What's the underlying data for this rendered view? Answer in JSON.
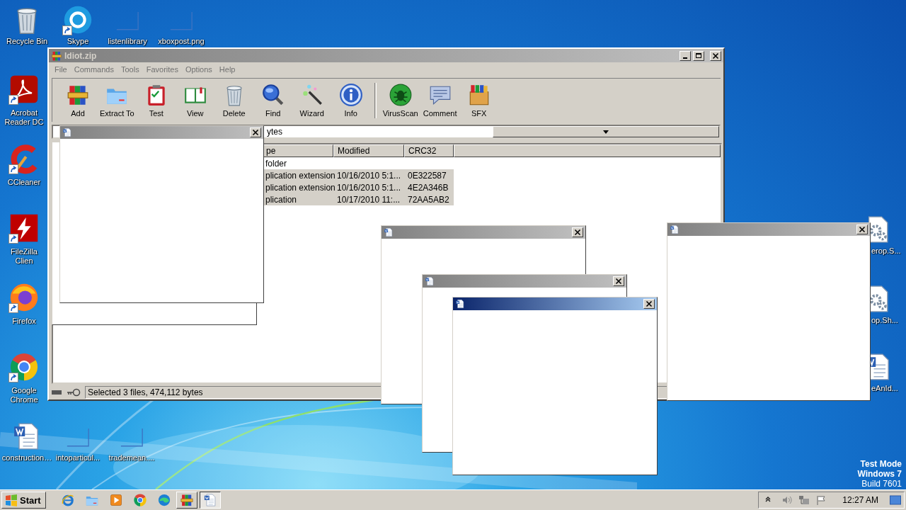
{
  "desktop_icons": [
    {
      "label": "Recycle Bin",
      "shortcut": false
    },
    {
      "label": "Skype",
      "shortcut": true
    },
    {
      "label": "listenlibrary",
      "shortcut": false
    },
    {
      "label": "xboxpost.png",
      "shortcut": false
    },
    {
      "label": "Acrobat Reader DC",
      "shortcut": true
    },
    {
      "label": "CCleaner",
      "shortcut": true
    },
    {
      "label": "FileZilla Clien",
      "shortcut": true
    },
    {
      "label": "Firefox",
      "shortcut": true
    },
    {
      "label": "Google Chrome",
      "shortcut": true
    },
    {
      "label": "construction…",
      "shortcut": false
    },
    {
      "label": "intoparticul...",
      "shortcut": false
    },
    {
      "label": "trademean....",
      "shortcut": false
    },
    {
      "label": "erop.S...",
      "shortcut": false
    },
    {
      "label": "op.Sh...",
      "shortcut": false
    },
    {
      "label": "eAnId...",
      "shortcut": false
    }
  ],
  "system_watermark": [
    "Test Mode",
    "Windows 7",
    "Build 7601"
  ],
  "winrar": {
    "title": "Idiot.zip",
    "menu": [
      "File",
      "Commands",
      "Tools",
      "Favorites",
      "Options",
      "Help"
    ],
    "toolbar": [
      {
        "label": "Add"
      },
      {
        "label": "Extract To"
      },
      {
        "label": "Test"
      },
      {
        "label": "View"
      },
      {
        "label": "Delete"
      },
      {
        "label": "Find"
      },
      {
        "label": "Wizard"
      },
      {
        "label": "Info"
      },
      {
        "label": "VirusScan",
        "kind": "after-separator"
      },
      {
        "label": "Comment"
      },
      {
        "label": "SFX"
      }
    ],
    "address": "ytes",
    "columns": [
      "pe",
      "Modified",
      "CRC32"
    ],
    "rows": [
      {
        "cells": [
          "folder"
        ],
        "selected": false
      },
      {
        "cells": [
          "plication extension",
          "10/16/2010 5:1...",
          "0E322587"
        ],
        "selected": true
      },
      {
        "cells": [
          "plication extension",
          "10/16/2010 5:1...",
          "4E2A346B"
        ],
        "selected": true
      },
      {
        "cells": [
          "plication",
          "10/17/2010 11:...",
          "72AA5AB2"
        ],
        "selected": true
      }
    ],
    "status": "Selected 3 files, 474,112 bytes"
  },
  "popups": [
    {
      "kind": "covered"
    },
    {
      "active": false
    },
    {
      "active": false
    },
    {
      "active": false
    },
    {
      "active": false
    },
    {
      "active": true
    }
  ],
  "taskbar": {
    "start": "Start",
    "buttons": [
      {
        "kind": "pin",
        "pressed": false
      },
      {
        "kind": "pin",
        "pressed": false
      },
      {
        "kind": "pin",
        "pressed": false
      },
      {
        "kind": "pin",
        "pressed": false
      },
      {
        "kind": "pin",
        "pressed": false
      },
      {
        "kind": "window",
        "pressed": false
      },
      {
        "kind": "window",
        "pressed": true
      }
    ],
    "clock": "12:27 AM"
  }
}
